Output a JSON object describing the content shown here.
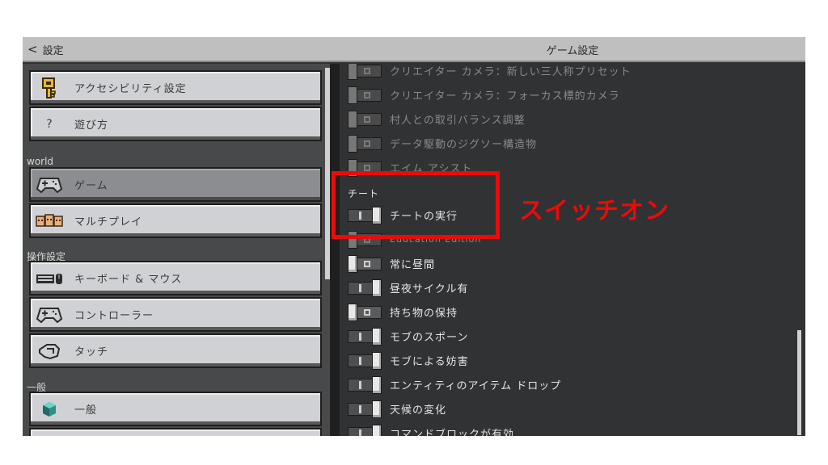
{
  "header": {
    "back_label": "設定",
    "title": "ゲーム設定"
  },
  "sidebar": {
    "items": [
      {
        "label": "アクセシビリティ設定",
        "icon": "key-icon"
      },
      {
        "label": "遊び方",
        "icon": "?"
      },
      {
        "section": "world"
      },
      {
        "label": "ゲーム",
        "icon": "gamepad-icon",
        "active": true
      },
      {
        "label": "マルチプレイ",
        "icon": "players-icon"
      },
      {
        "section": "操作設定"
      },
      {
        "label": "キーボード & マウス",
        "icon": "keyboard-mouse-icon"
      },
      {
        "label": "コントローラー",
        "icon": "controller-icon"
      },
      {
        "label": "タッチ",
        "icon": "touch-hand-icon"
      },
      {
        "section": "一般"
      },
      {
        "label": "一般",
        "icon": "cube-icon"
      }
    ]
  },
  "settings": {
    "experimental": [
      {
        "label": "クリエイター カメラ：新しい三人称プリセット",
        "state": "off"
      },
      {
        "label": "クリエイター カメラ：フォーカス標的カメラ",
        "state": "off"
      },
      {
        "label": "村人との取引バランス調整",
        "state": "off"
      },
      {
        "label": "データ駆動のジグソー構造物",
        "state": "off"
      },
      {
        "label": "エイム アシスト",
        "state": "off"
      }
    ],
    "cheats_section": "チート",
    "cheats": [
      {
        "label": "チートの実行",
        "state": "on"
      },
      {
        "label": "Education Edition",
        "state": "off",
        "disabled": true
      },
      {
        "label": "常に昼間",
        "state": "off"
      },
      {
        "label": "昼夜サイクル有",
        "state": "on"
      },
      {
        "label": "持ち物の保持",
        "state": "off"
      },
      {
        "label": "モブのスポーン",
        "state": "on"
      },
      {
        "label": "モブによる妨害",
        "state": "on"
      },
      {
        "label": "エンティティのアイテム ドロップ",
        "state": "on"
      },
      {
        "label": "天候の変化",
        "state": "on"
      },
      {
        "label": "コマンドブロックが有効",
        "state": "on"
      }
    ]
  },
  "annotation": {
    "text": "スイッチオン",
    "color": "#ec0a0a"
  }
}
